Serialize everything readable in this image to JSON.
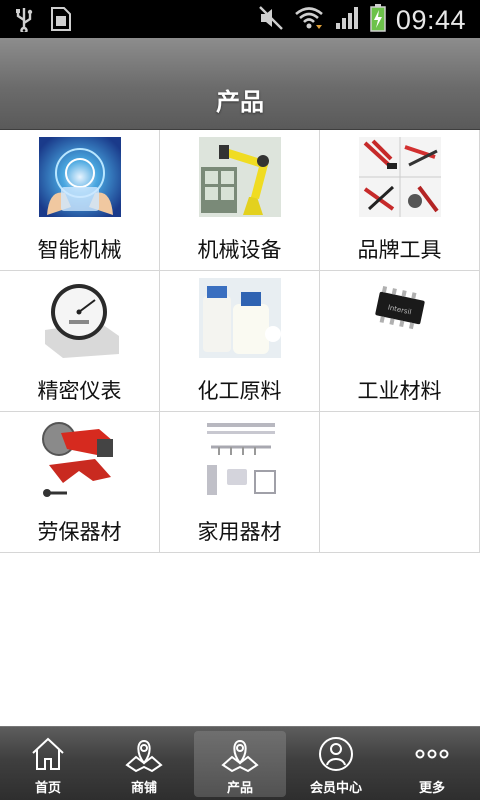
{
  "status_bar": {
    "time": "09:44"
  },
  "header": {
    "title": "产品"
  },
  "products": [
    {
      "label": "智能机械",
      "icon": "smart-machinery-image"
    },
    {
      "label": "机械设备",
      "icon": "robot-arm-image"
    },
    {
      "label": "品牌工具",
      "icon": "pliers-tools-image"
    },
    {
      "label": "精密仪表",
      "icon": "pressure-gauge-image"
    },
    {
      "label": "化工原料",
      "icon": "chemical-bottles-image"
    },
    {
      "label": "工业材料",
      "icon": "ic-chip-image"
    },
    {
      "label": "劳保器材",
      "icon": "cutting-saw-image"
    },
    {
      "label": "家用器材",
      "icon": "bathroom-rack-image"
    }
  ],
  "bottom_nav": {
    "active": "产品",
    "items": [
      {
        "label": "首页",
        "icon": "home-icon"
      },
      {
        "label": "商铺",
        "icon": "map-icon"
      },
      {
        "label": "产品",
        "icon": "map-icon"
      },
      {
        "label": "会员中心",
        "icon": "user-icon"
      },
      {
        "label": "更多",
        "icon": "more-icon"
      }
    ]
  }
}
